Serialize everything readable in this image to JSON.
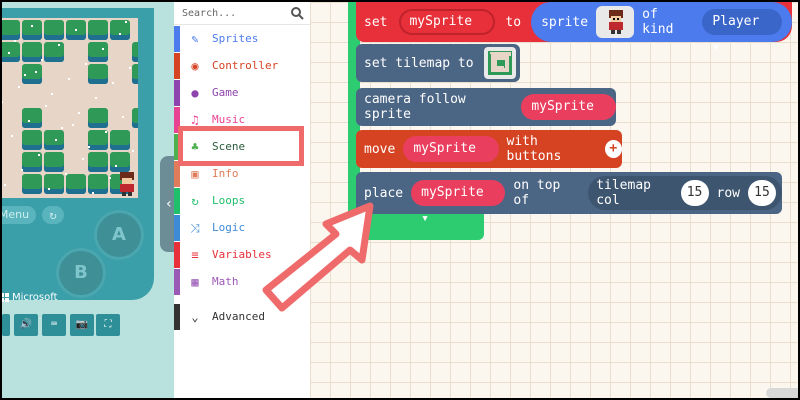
{
  "simulator": {
    "menu_label": "Menu",
    "restart_glyph": "↻",
    "a_label": "A",
    "b_label": "B",
    "brand": "Microsoft",
    "toolbar_glyphs": [
      "",
      "🔊",
      "⌨",
      "📷",
      "⛶"
    ]
  },
  "toolbox": {
    "search_placeholder": "Search...",
    "categories": [
      {
        "label": "Sprites",
        "color": "#4b7bec",
        "icon": "sprites-icon"
      },
      {
        "label": "Controller",
        "color": "#d54322",
        "icon": "controller-icon"
      },
      {
        "label": "Game",
        "color": "#8e44ad",
        "icon": "game-icon"
      },
      {
        "label": "Music",
        "color": "#e84393",
        "icon": "music-icon"
      },
      {
        "label": "Scene",
        "color": "#4caf50",
        "icon": "tree-icon"
      },
      {
        "label": "Info",
        "color": "#e07c5a",
        "icon": "info-icon"
      },
      {
        "label": "Loops",
        "color": "#20bf6b",
        "icon": "loops-icon"
      },
      {
        "label": "Logic",
        "color": "#3d8bd6",
        "icon": "logic-icon"
      },
      {
        "label": "Variables",
        "color": "#e8303a",
        "icon": "variables-icon"
      },
      {
        "label": "Math",
        "color": "#9b59b6",
        "icon": "math-icon"
      },
      {
        "label": "Advanced",
        "color": "#333333",
        "icon": "chevron-down-icon"
      }
    ]
  },
  "blocks": {
    "set": {
      "kw": "set",
      "var": "mySprite",
      "to": "to",
      "sprite": "sprite",
      "of_kind": "of kind",
      "kind": "Player"
    },
    "tilemap": {
      "label": "set tilemap to"
    },
    "camera": {
      "label": "camera follow sprite",
      "var": "mySprite"
    },
    "move": {
      "kw": "move",
      "var": "mySprite",
      "suffix": "with buttons"
    },
    "place": {
      "kw": "place",
      "var": "mySprite",
      "on_top": "on top of",
      "tilemap_col": "tilemap col",
      "col": "15",
      "row_label": "row",
      "row": "15"
    }
  },
  "colors": {
    "workspace": "#fbf6ee",
    "highlight": "#ef6b6b",
    "scene_block": "#4b6584",
    "sprite_block": "#4b7bec",
    "controller_block": "#d54322",
    "variable_pill": "#ea3e5e",
    "loop_block": "#2ecc71"
  }
}
